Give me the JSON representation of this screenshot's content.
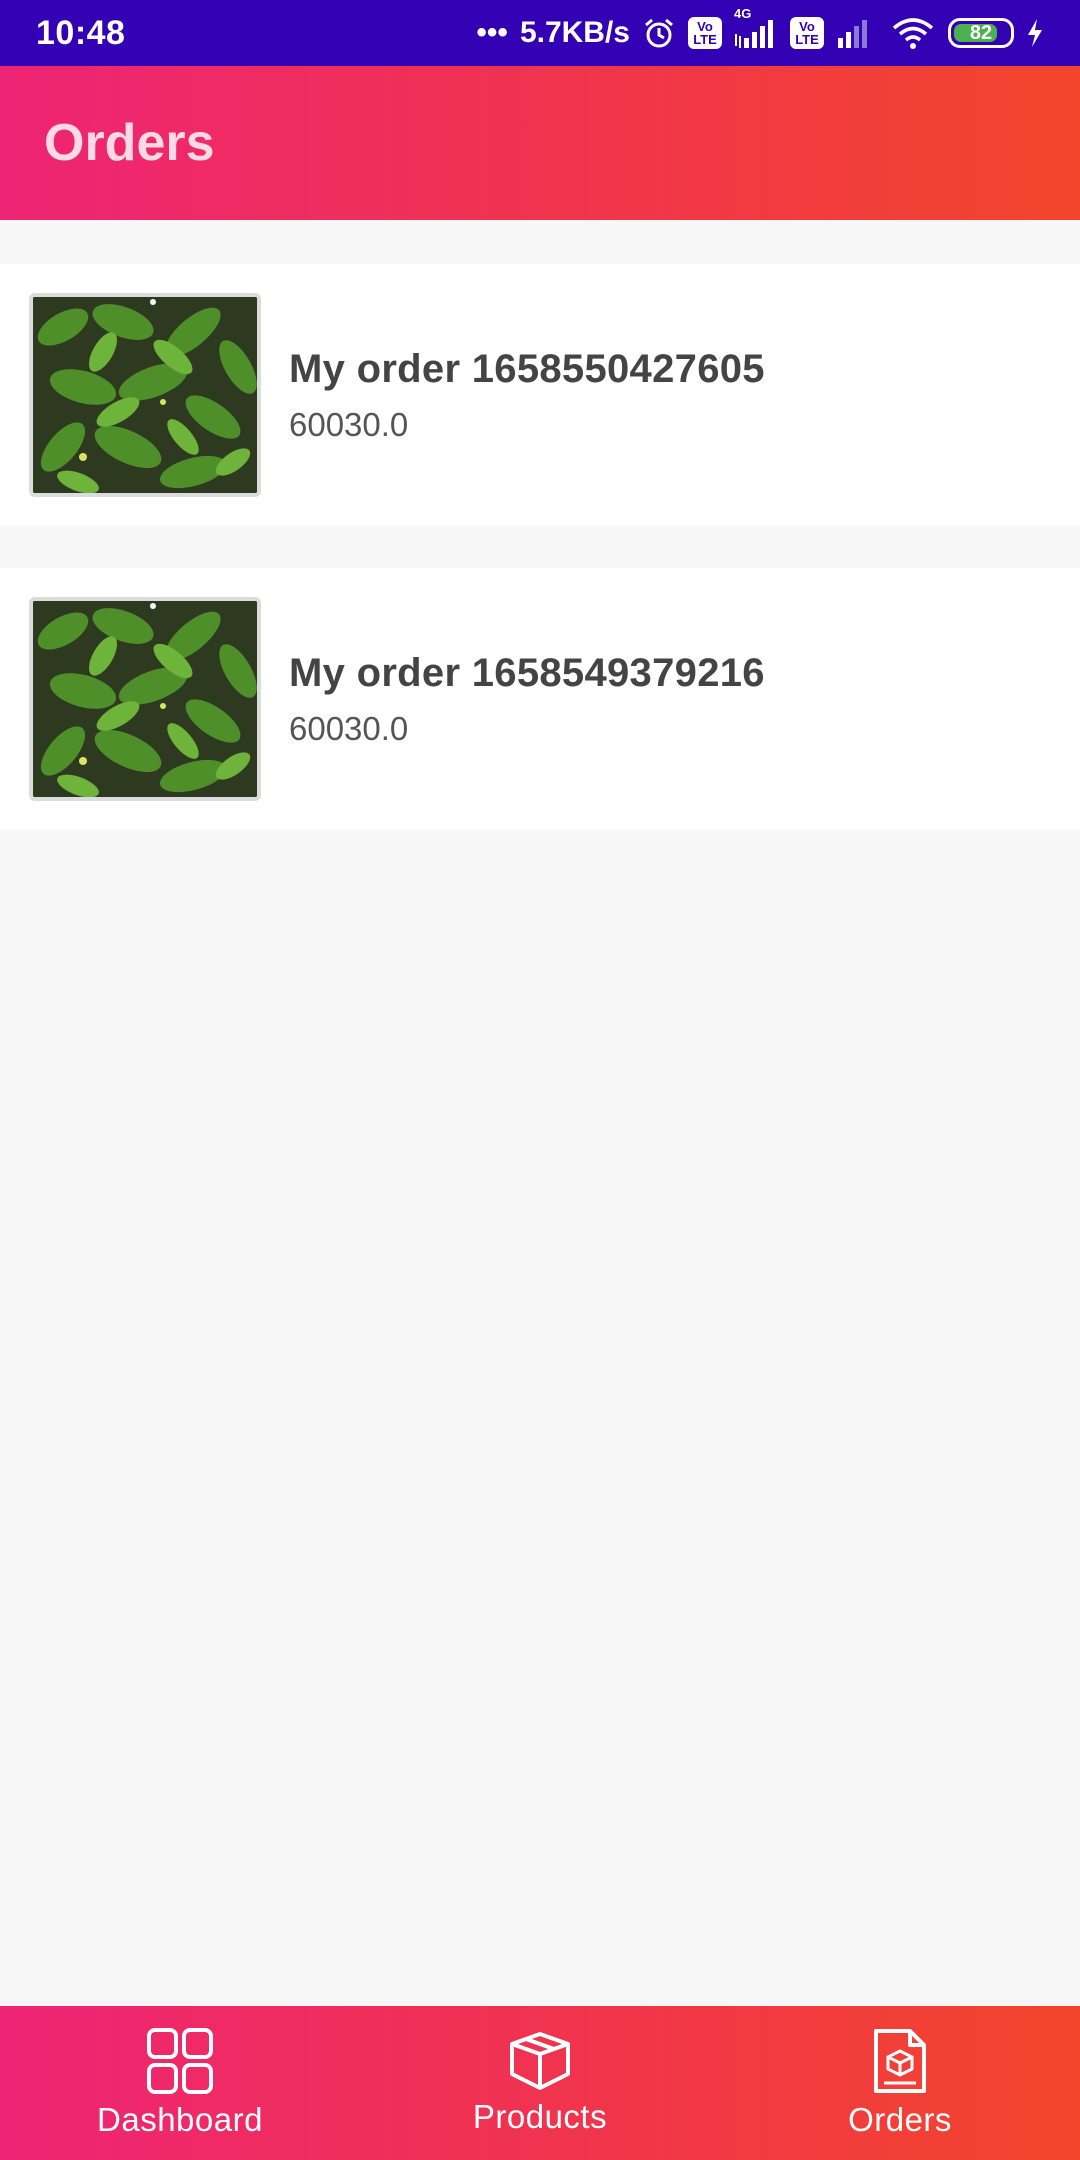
{
  "status_bar": {
    "time": "10:48",
    "net_speed": "5.7KB/s",
    "network_label": "4G",
    "volte1": "Vo",
    "volte1_sub": "LTE",
    "volte2": "Vo",
    "volte2_sub": "LTE",
    "battery_level": "82",
    "battery_fraction": 0.82
  },
  "app_bar": {
    "title": "Orders"
  },
  "orders": [
    {
      "title": "My order 1658550427605",
      "amount": "60030.0",
      "image_icon": "leafy-plant-photo"
    },
    {
      "title": "My order 1658549379216",
      "amount": "60030.0",
      "image_icon": "leafy-plant-photo"
    }
  ],
  "bottom_nav": {
    "items": [
      {
        "label": "Dashboard",
        "icon": "grid-icon"
      },
      {
        "label": "Products",
        "icon": "box-icon"
      },
      {
        "label": "Orders",
        "icon": "document-box-icon"
      }
    ]
  },
  "colors": {
    "status_bar": "#3300b3",
    "gradient_start": "#ee2475",
    "gradient_end": "#f3452c",
    "background": "#f7f7f7",
    "title_text": "#444444"
  }
}
